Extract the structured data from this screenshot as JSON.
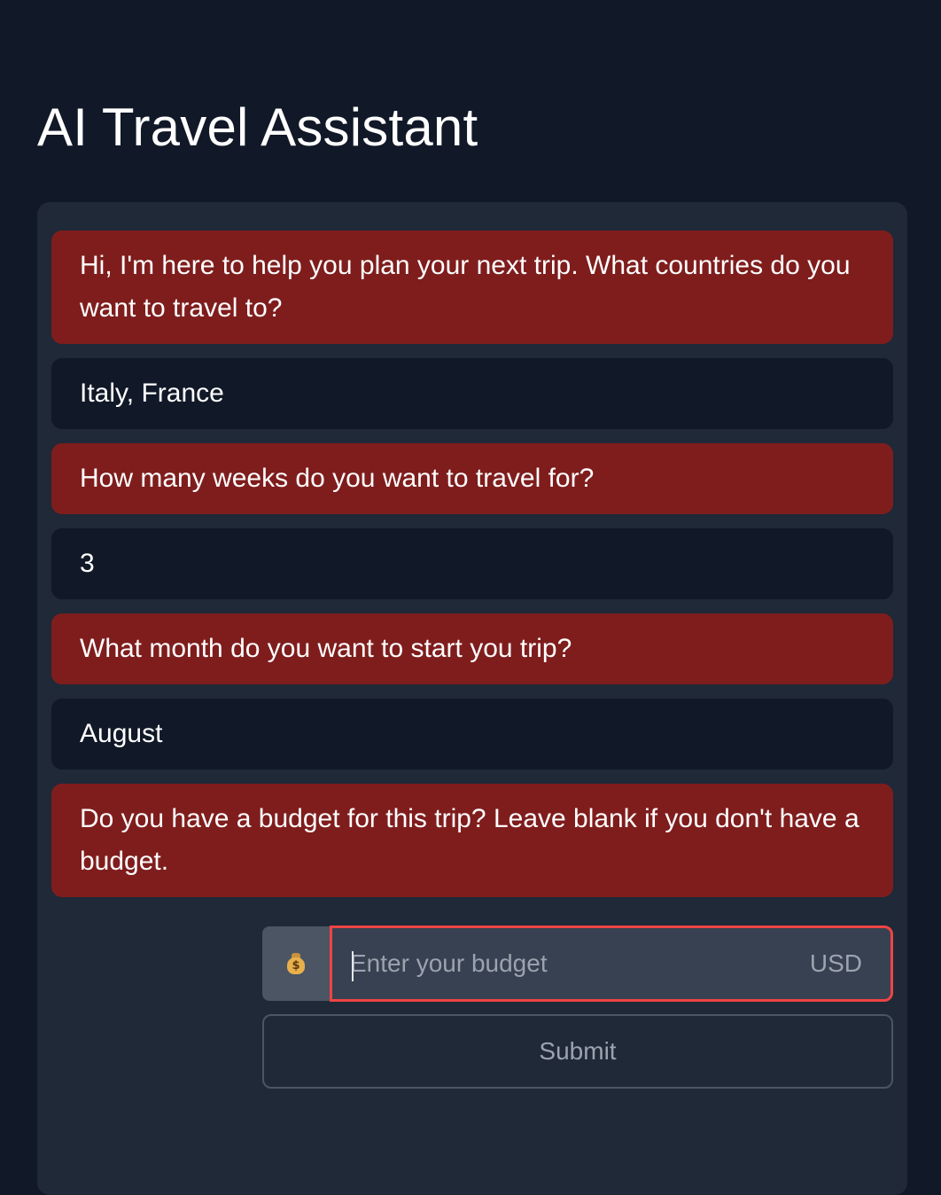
{
  "header": {
    "title": "AI Travel Assistant"
  },
  "conversation": [
    {
      "role": "assistant",
      "text": "Hi, I'm here to help you plan your next trip. What countries do you want to travel to?"
    },
    {
      "role": "user",
      "text": "Italy, France"
    },
    {
      "role": "assistant",
      "text": "How many weeks do you want to travel for?"
    },
    {
      "role": "user",
      "text": "3"
    },
    {
      "role": "assistant",
      "text": "What month do you want to start you trip?"
    },
    {
      "role": "user",
      "text": "August"
    },
    {
      "role": "assistant",
      "text": "Do you have a budget for this trip? Leave blank if you don't have a budget."
    }
  ],
  "budget_form": {
    "prefix_icon": "money-bag-icon",
    "prefix_symbol": "$",
    "placeholder": "Enter your budget",
    "value": "",
    "currency": "USD",
    "submit_label": "Submit"
  },
  "colors": {
    "page_bg": "#111827",
    "panel_bg": "#1f2937",
    "assistant_bubble": "#7f1d1d",
    "user_bubble": "#111827",
    "focus_border": "#ef4444"
  }
}
